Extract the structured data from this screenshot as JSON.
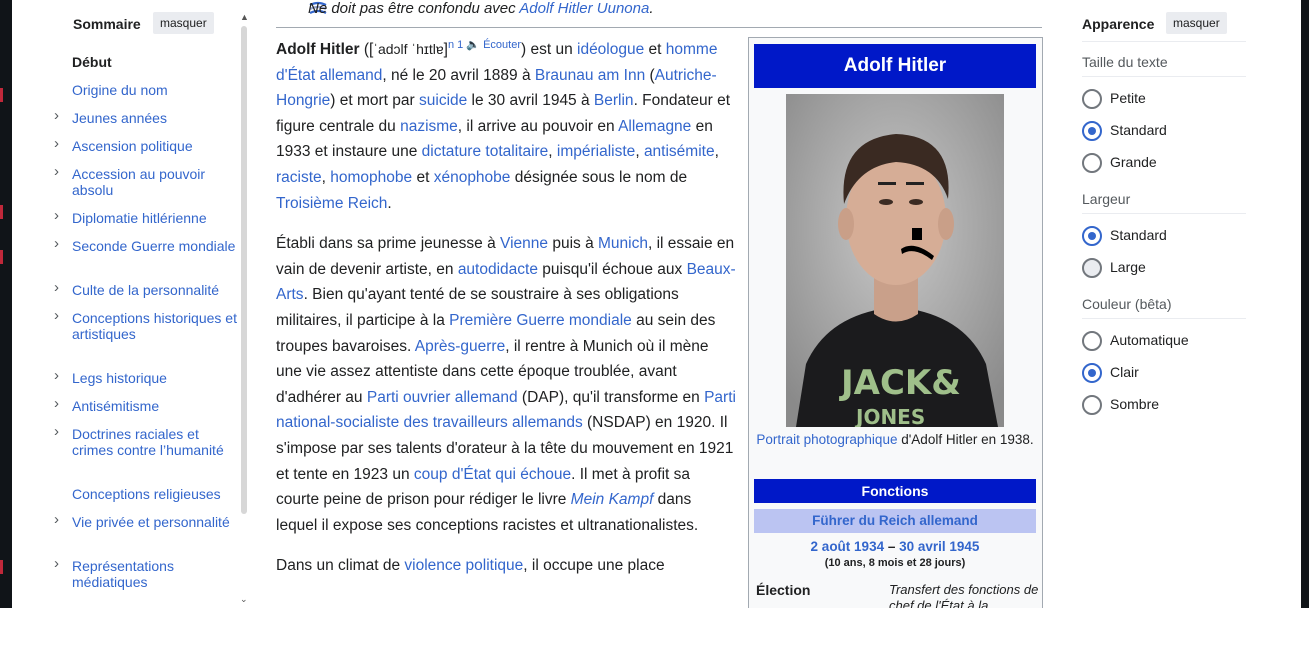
{
  "hatnote": {
    "prefix": "Ne doit pas être confondu avec ",
    "link": "Adolf Hitler Uunona",
    "suffix": "."
  },
  "toc": {
    "title": "Sommaire",
    "hide_label": "masquer",
    "items": [
      {
        "label": "Début",
        "chevron": false,
        "current": true
      },
      {
        "label": "Origine du nom",
        "chevron": false
      },
      {
        "label": "Jeunes années",
        "chevron": true
      },
      {
        "label": "Ascension politique",
        "chevron": true
      },
      {
        "label": "Accession au pouvoir absolu",
        "chevron": true
      },
      {
        "label": "Diplomatie hitlérienne",
        "chevron": true
      },
      {
        "label": "Seconde Guerre mondiale",
        "chevron": true
      },
      {
        "label": "Culte de la personnalité",
        "chevron": true
      },
      {
        "label": "Conceptions historiques et artistiques",
        "chevron": true
      },
      {
        "label": "Legs historique",
        "chevron": true
      },
      {
        "label": "Antisémitisme",
        "chevron": true
      },
      {
        "label": "Doctrines raciales et crimes contre l’humanité",
        "chevron": true
      },
      {
        "label": "Conceptions religieuses",
        "chevron": false
      },
      {
        "label": "Vie privée et personnalité",
        "chevron": true
      },
      {
        "label": "Représentations médiatiques",
        "chevron": true
      }
    ]
  },
  "article": {
    "p1": [
      {
        "t": "Adolf Hitler",
        "b": true
      },
      {
        "t": " (["
      },
      {
        "t": "ˈadɔlf ˈhɪtlɐ",
        "ipa": true
      },
      {
        "t": "]"
      },
      {
        "t": "n 1",
        "l": true,
        "sup": true
      },
      {
        "t": " 🔈 ",
        "sup": true
      },
      {
        "t": "Écouter",
        "l": true,
        "sup": true
      },
      {
        "t": ") est un "
      },
      {
        "t": "idéologue",
        "l": true
      },
      {
        "t": " et "
      },
      {
        "t": "homme d'État allemand",
        "l": true
      },
      {
        "t": ", né le 20 avril 1889 à "
      },
      {
        "t": "Braunau am Inn",
        "l": true
      },
      {
        "t": " ("
      },
      {
        "t": "Autriche-Hongrie",
        "l": true
      },
      {
        "t": ") et mort par "
      },
      {
        "t": "suicide",
        "l": true
      },
      {
        "t": " le 30 avril 1945 à "
      },
      {
        "t": "Berlin",
        "l": true
      },
      {
        "t": ". Fondateur et figure centrale du "
      },
      {
        "t": "nazisme",
        "l": true
      },
      {
        "t": ", il arrive au pouvoir en "
      },
      {
        "t": "Allemagne",
        "l": true
      },
      {
        "t": " en 1933 et instaure une "
      },
      {
        "t": "dictature totalitaire",
        "l": true
      },
      {
        "t": ", "
      },
      {
        "t": "impérialiste",
        "l": true
      },
      {
        "t": ", "
      },
      {
        "t": "antisémite",
        "l": true
      },
      {
        "t": ", "
      },
      {
        "t": "raciste",
        "l": true
      },
      {
        "t": ", "
      },
      {
        "t": "homophobe",
        "l": true
      },
      {
        "t": " et "
      },
      {
        "t": "xénophobe",
        "l": true
      },
      {
        "t": " désignée sous le nom de "
      },
      {
        "t": "Troisième Reich",
        "l": true
      },
      {
        "t": "."
      }
    ],
    "p2": [
      {
        "t": "Établi dans sa prime jeunesse à "
      },
      {
        "t": "Vienne",
        "l": true
      },
      {
        "t": " puis à "
      },
      {
        "t": "Munich",
        "l": true
      },
      {
        "t": ", il essaie en vain de devenir artiste, en "
      },
      {
        "t": "autodidacte",
        "l": true
      },
      {
        "t": " puisqu'il échoue aux "
      },
      {
        "t": "Beaux-Arts",
        "l": true
      },
      {
        "t": ". Bien qu'ayant tenté de se soustraire à ses obligations militaires, il participe à la "
      },
      {
        "t": "Première Guerre mondiale",
        "l": true
      },
      {
        "t": " au sein des troupes bavaroises. "
      },
      {
        "t": "Après-guerre",
        "l": true
      },
      {
        "t": ", il rentre à Munich où il mène une vie assez attentiste dans cette époque troublée, avant d'adhérer au "
      },
      {
        "t": "Parti ouvrier allemand",
        "l": true
      },
      {
        "t": " (DAP), qu'il transforme en "
      },
      {
        "t": "Parti national-socialiste des travailleurs allemands",
        "l": true
      },
      {
        "t": " (NSDAP) en 1920. Il s'impose par ses talents d'orateur à la tête du mouvement en 1921 et tente en 1923 un "
      },
      {
        "t": "coup d'État qui échoue",
        "l": true
      },
      {
        "t": ". Il met à profit sa courte peine de prison pour rédiger le livre "
      },
      {
        "t": "Mein Kampf",
        "l": true,
        "i": true
      },
      {
        "t": " dans lequel il expose ses conceptions racistes et ultranationalistes."
      }
    ],
    "p3": [
      {
        "t": "Dans un climat de "
      },
      {
        "t": "violence politique",
        "l": true
      },
      {
        "t": ", il occupe une place"
      }
    ]
  },
  "infobox": {
    "title": "Adolf Hitler",
    "photo_alt": "Portrait photographique",
    "caption_link": "Portrait photographique",
    "caption_text": " d'Adolf Hitler en 1938.",
    "section": "Fonctions",
    "role": "Führer du Reich allemand",
    "date_start": "2 août 1934",
    "date_sep": " – ",
    "date_end": "30 avril 1945",
    "duration": "(10 ans, 8 mois et 28 jours)",
    "election_label": "Élection",
    "election_value": "Transfert des fonctions de chef de l'État à la"
  },
  "appearance": {
    "title": "Apparence",
    "hide_label": "masquer",
    "text_size_label": "Taille du texte",
    "text_size_options": [
      {
        "label": "Petite",
        "selected": false
      },
      {
        "label": "Standard",
        "selected": true
      },
      {
        "label": "Grande",
        "selected": false
      }
    ],
    "width_label": "Largeur",
    "width_options": [
      {
        "label": "Standard",
        "selected": true
      },
      {
        "label": "Large",
        "selected": false
      }
    ],
    "color_label": "Couleur (bêta)",
    "color_options": [
      {
        "label": "Automatique",
        "selected": false
      },
      {
        "label": "Clair",
        "selected": true
      },
      {
        "label": "Sombre",
        "selected": false
      }
    ]
  },
  "colors": {
    "link": "#3366cc",
    "infobox_header": "#0018c8",
    "infobox_role_bg": "#bbc4f2"
  }
}
